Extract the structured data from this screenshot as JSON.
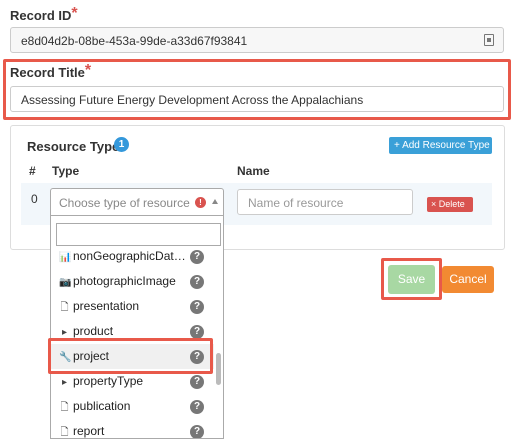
{
  "record_id": {
    "label": "Record ID",
    "required_mark": "*",
    "value": "e8d04d2b-08be-453a-99de-a33d67f93841"
  },
  "record_title": {
    "label": "Record Title",
    "required_mark": "*",
    "value": "Assessing Future Energy Development Across the Appalachians"
  },
  "resource_types": {
    "label": "Resource Types",
    "count": "1",
    "add_button": "+ Add Resource Type",
    "columns": {
      "num": "#",
      "type": "Type",
      "name": "Name"
    },
    "row": {
      "index": "0",
      "type_placeholder": "Choose type of resource",
      "error_mark": "!",
      "name_placeholder": "Name of resource",
      "delete_label": "× Delete"
    }
  },
  "dropdown": {
    "items": [
      {
        "label": "nonGeographicDat…",
        "icon": "bar-chart-icon",
        "glyph": "📊",
        "help": "?"
      },
      {
        "label": "photographicImage",
        "icon": "camera-icon",
        "glyph": "📷",
        "help": "?"
      },
      {
        "label": "presentation",
        "icon": "document-icon",
        "glyph": "🗋",
        "help": "?"
      },
      {
        "label": "product",
        "icon": "caret-right-icon",
        "glyph": "▸",
        "help": "?"
      },
      {
        "label": "project",
        "icon": "wrench-icon",
        "glyph": "🔧",
        "help": "?"
      },
      {
        "label": "propertyType",
        "icon": "caret-right-icon",
        "glyph": "▸",
        "help": "?"
      },
      {
        "label": "publication",
        "icon": "document-icon",
        "glyph": "🗋",
        "help": "?"
      },
      {
        "label": "report",
        "icon": "document-icon",
        "glyph": "🗋",
        "help": "?"
      }
    ]
  },
  "actions": {
    "save": "Save",
    "cancel": "Cancel"
  },
  "colors": {
    "highlight": "#e8594a",
    "save": "#a8d8a3",
    "cancel": "#f28a32",
    "add": "#3aa0d8",
    "delete": "#d9534f"
  }
}
